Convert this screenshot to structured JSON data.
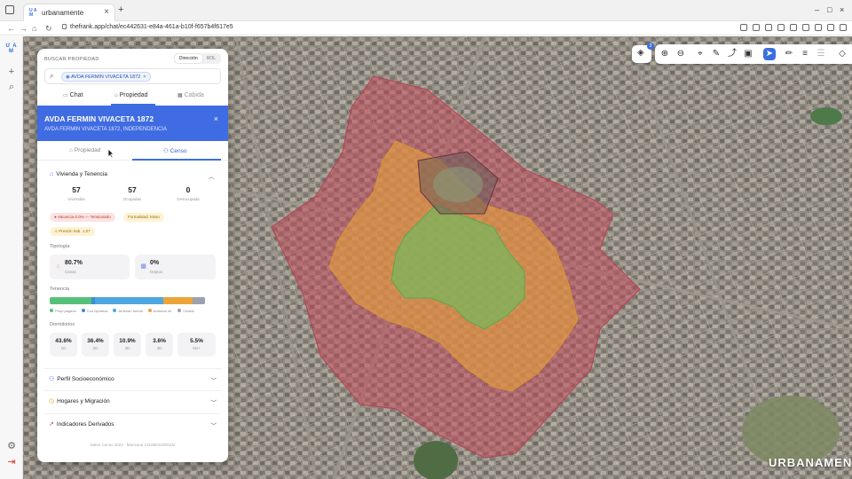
{
  "browser": {
    "tab_title": "urbanamente",
    "tab_favicon": "U A M",
    "url": "thefrank.app/chat/ec442631-e84a-461a-b10f-f657b4f617e5"
  },
  "rail": {
    "logo": "U A M"
  },
  "search": {
    "header": "BUSCAR PROPIEDAD",
    "mode_options": [
      "Dirección",
      "ROL"
    ],
    "mode_selected": "Dirección",
    "chip": "AVDA FERMIN VIVACETA 1872"
  },
  "tabs": [
    "Chat",
    "Propiedad",
    "Cabida"
  ],
  "tab_selected": "Propiedad",
  "property": {
    "title": "AVDA FERMIN VIVACETA 1872",
    "subtitle": "AVDA FERMIN VIVACETA 1872, INDEPENDENCIA"
  },
  "subtabs": [
    "Propiedad",
    "Censo"
  ],
  "subtab_selected": "Censo",
  "vivienda": {
    "title": "Vivienda y Tenencia",
    "stats": [
      {
        "value": "57",
        "label": "Viviendas"
      },
      {
        "value": "57",
        "label": "Ocupadas"
      },
      {
        "value": "0",
        "label": "Desocupada"
      }
    ],
    "pills": [
      {
        "text": "Vacancia 0.0% — Tensionado",
        "color": "red"
      },
      {
        "text": "Formalidad: Mixto",
        "color": "yel"
      },
      {
        "text": "Presión hab. 1.07",
        "color": "yel"
      }
    ],
    "tipologia_label": "Tipología",
    "tipologia": [
      {
        "value": "80.7%",
        "label": "Casas",
        "icon": "house-icon",
        "color": "#f3a53b"
      },
      {
        "value": "0%",
        "label": "Deptos",
        "icon": "building-icon",
        "color": "#6b8de6"
      }
    ],
    "tenencia_label": "Tenencia",
    "tenencia": [
      {
        "label": "Propi pagado",
        "share": 0.27,
        "color": "#57c07a"
      },
      {
        "label": "Con hipoteca",
        "share": 0.02,
        "color": "#3a8fd0"
      },
      {
        "label": "Arriendo formal",
        "share": 0.44,
        "color": "#4ea6e0"
      },
      {
        "label": "Arriendo inf.",
        "share": 0.19,
        "color": "#eba43a"
      },
      {
        "label": "Cedido",
        "share": 0.08,
        "color": "#9aa2ad"
      }
    ],
    "dormitorios_label": "Dormitorios",
    "dormitorios": [
      {
        "value": "43.6%",
        "label": "1D"
      },
      {
        "value": "36.4%",
        "label": "2D"
      },
      {
        "value": "10.9%",
        "label": "3D"
      },
      {
        "value": "3.6%",
        "label": "4D"
      },
      {
        "value": "5.5%",
        "label": "5D+"
      }
    ]
  },
  "collapsed_sections": [
    {
      "title": "Perfil Socioeconómico",
      "icon": "people-icon",
      "color": "#3b6fe0"
    },
    {
      "title": "Hogares y Migración",
      "icon": "clock-icon",
      "color": "#e0a020"
    },
    {
      "title": "Indicadores Derivados",
      "icon": "trend-icon",
      "color": "#d64545"
    }
  ],
  "footer": "Datos Censo 2024 · Manzana 13108031000102",
  "map": {
    "layers_badge": "3",
    "watermark": "URBANAMENTE"
  }
}
